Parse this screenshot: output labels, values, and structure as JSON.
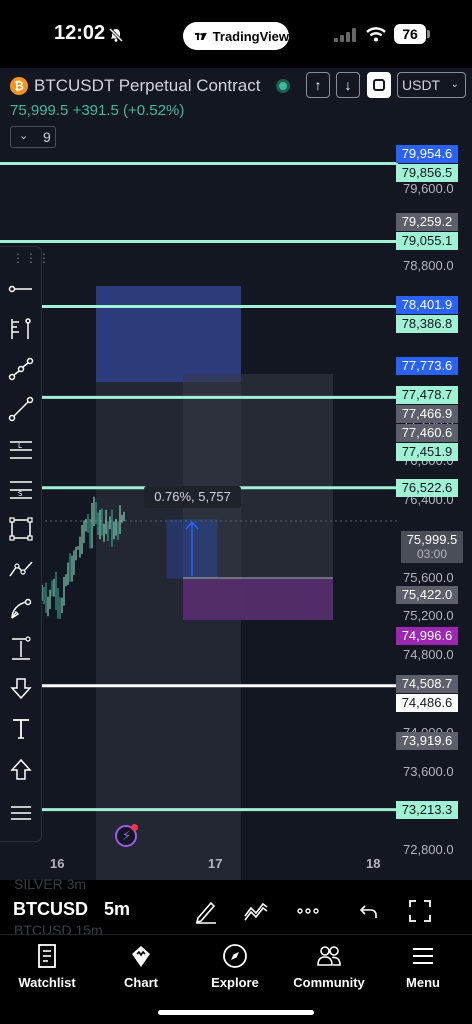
{
  "status_bar": {
    "time": "12:02",
    "pill_label": "TradingView",
    "battery": "76"
  },
  "header": {
    "coin_glyph": "₿",
    "symbol_title": "BTCUSDT Perpetual Contract",
    "price": "75,999.5",
    "change": "+391.5 (+0.52%)",
    "currency": "USDT",
    "indicator_count": "9",
    "up_glyph": "↑",
    "down_glyph": "↓",
    "chevron_glyph": "⌄"
  },
  "price_ticks": [
    "79,600.0",
    "78,800.0",
    "77,200.0",
    "76,800.0",
    "76,400.0",
    "75,600.0",
    "75,200.0",
    "74,800.0",
    "74,000.0",
    "73,600.0",
    "72,800.0"
  ],
  "price_levels": [
    {
      "value": 79954.6,
      "label": "79,954.6",
      "color": "#2962ff",
      "line": false
    },
    {
      "value": 79856.5,
      "label": "79,856.5",
      "color": "#9ff2d3",
      "line": true,
      "dark_text": true
    },
    {
      "value": 79259.2,
      "label": "79,259.2",
      "color": "#5d606b",
      "line": false
    },
    {
      "value": 79055.1,
      "label": "79,055.1",
      "color": "#9ff2d3",
      "line": true,
      "dark_text": true
    },
    {
      "value": 78401.9,
      "label": "78,401.9",
      "color": "#2962ff",
      "line": false
    },
    {
      "value": 78386.8,
      "label": "78,386.8",
      "color": "#9ff2d3",
      "line": true,
      "dark_text": true
    },
    {
      "value": 77773.6,
      "label": "77,773.6",
      "color": "#2962ff",
      "line": false
    },
    {
      "value": 77478.7,
      "label": "77,478.7",
      "color": "#9ff2d3",
      "line": false,
      "dark_text": true
    },
    {
      "value": 77466.9,
      "label": "77,466.9",
      "color": "#5d606b",
      "line": false
    },
    {
      "value": 77460.6,
      "label": "77,460.6",
      "color": "#5d606b",
      "line": false
    },
    {
      "value": 77451.9,
      "label": "77,451.9",
      "color": "#9ff2d3",
      "line": true,
      "dark_text": true
    },
    {
      "value": 76522.6,
      "label": "76,522.6",
      "color": "#9ff2d3",
      "line": true,
      "dark_text": true
    },
    {
      "value": 75422.0,
      "label": "75,422.0",
      "color": "#5d606b",
      "line": false
    },
    {
      "value": 74996.6,
      "label": "74,996.6",
      "color": "#9c27b0",
      "line": false
    },
    {
      "value": 74508.7,
      "label": "74,508.7",
      "color": "#5d606b",
      "line": false
    },
    {
      "value": 74486.6,
      "label": "74,486.6",
      "color": "#ffffff",
      "line": true,
      "dark_text": true
    },
    {
      "value": 73919.6,
      "label": "73,919.6",
      "color": "#5d606b",
      "line": false
    },
    {
      "value": 73213.3,
      "label": "73,213.3",
      "color": "#9ff2d3",
      "line": true,
      "dark_text": true
    }
  ],
  "current_price": {
    "value": 75999.5,
    "label": "75,999.5",
    "countdown": "03:00"
  },
  "measure": {
    "label": "0.76%, 5,757"
  },
  "time_ticks": [
    "16",
    "17",
    "18"
  ],
  "bottom_bar": {
    "symbol": "BTCUSD",
    "interval": "5m",
    "ghost_top": "SILVER        3m",
    "ghost_bottom": "BTCUSD        15m"
  },
  "tabs": [
    {
      "label": "Watchlist",
      "icon": "watchlist-icon"
    },
    {
      "label": "Chart",
      "icon": "chart-icon"
    },
    {
      "label": "Explore",
      "icon": "compass-icon"
    },
    {
      "label": "Community",
      "icon": "community-icon"
    },
    {
      "label": "Menu",
      "icon": "menu-icon"
    }
  ],
  "colors": {
    "background": "#131722",
    "up": "#3fb99d",
    "level_line": "#9ff2d3",
    "accent": "#2962ff",
    "target_zone": "#9c27b0"
  }
}
